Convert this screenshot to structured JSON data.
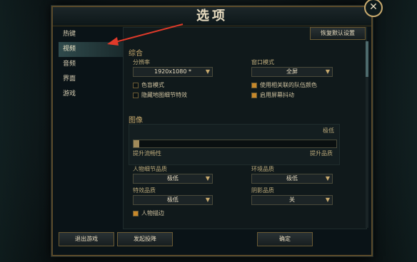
{
  "title": "选项",
  "close_glyph": "✕",
  "nav": [
    {
      "label": "热键"
    },
    {
      "label": "视频"
    },
    {
      "label": "音频"
    },
    {
      "label": "界面"
    },
    {
      "label": "游戏"
    }
  ],
  "restore_defaults": "恢复默认设置",
  "general": {
    "header": "综合",
    "resolution_label": "分辨率",
    "resolution_value": "1920x1080 *",
    "window_mode_label": "窗口模式",
    "window_mode_value": "全屏",
    "colorblind": "色盲模式",
    "hide_eye_candy": "隐藏地图细节特效",
    "use_team_colors": "使用相关联的队伍颜色",
    "screen_shake": "启用屏幕抖动"
  },
  "graphics": {
    "header": "图像",
    "level": "极低",
    "left_hint": "提升流畅性",
    "right_hint": "提升品质",
    "character_quality_label": "人物细节品质",
    "character_quality_value": "极低",
    "environment_quality_label": "环境品质",
    "environment_quality_value": "极低",
    "effects_quality_label": "特效品质",
    "effects_quality_value": "极低",
    "shadow_quality_label": "阴影品质",
    "shadow_quality_value": "关",
    "character_outline": "人物描边"
  },
  "bottom": {
    "exit_game": "退出游戏",
    "surrender": "发起投降",
    "ok": "确定"
  }
}
